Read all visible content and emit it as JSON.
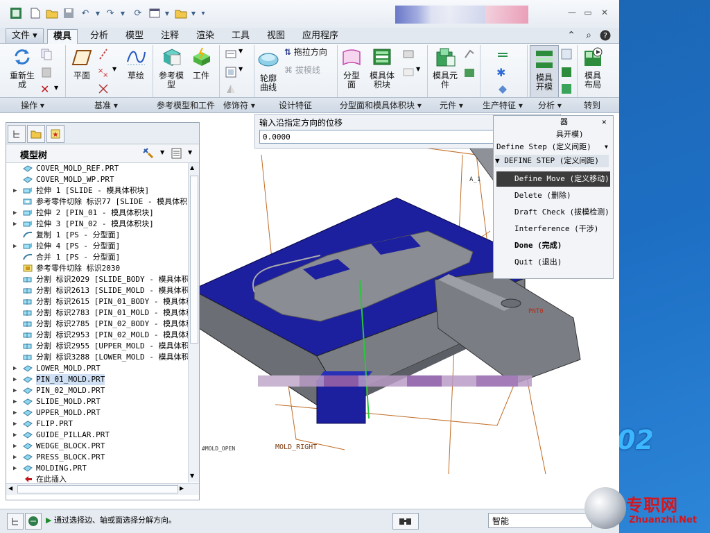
{
  "quick_access": {
    "icons": [
      "app-icon",
      "new-icon",
      "open-icon",
      "save-icon",
      "undo-icon",
      "redo-icon",
      "regenerate-icon",
      "windows-icon",
      "folder-icon",
      "customize-icon"
    ]
  },
  "tabs": [
    {
      "label": "文件",
      "kind": "file"
    },
    {
      "label": "模具",
      "active": true
    },
    {
      "label": "分析"
    },
    {
      "label": "模型"
    },
    {
      "label": "注释"
    },
    {
      "label": "渲染"
    },
    {
      "label": "工具"
    },
    {
      "label": "视图"
    },
    {
      "label": "应用程序"
    }
  ],
  "ribbon": {
    "buttons": {
      "regenerate": "重新生\n成",
      "plane": "平面",
      "sketch": "草绘",
      "ref_model": "参考模\n型",
      "workpiece": "工件",
      "contour_curve": "轮廓\n曲线",
      "drag_direction": "拖拉方向",
      "draft_line": "拔模线",
      "parting_surface": "分型\n面",
      "mold_volume": "模具体\n积块",
      "mold_component": "模具元\n件",
      "mold_open": "模具\n开模",
      "mold_layout": "模具\n布局"
    },
    "groups": [
      "操作",
      "基准",
      "参考模型和工件",
      "修饰符",
      "设计特征",
      "分型面和模具体积块",
      "元件",
      "生产特征",
      "分析",
      "转到"
    ]
  },
  "model_tree": {
    "title": "模型树",
    "rows": [
      {
        "label": "COVER_MOLD_REF.PRT",
        "icon": "part",
        "expand": false
      },
      {
        "label": "COVER_MOLD_WP.PRT",
        "icon": "part",
        "expand": false
      },
      {
        "label": "拉伸 1 [SLIDE - 模具体积块]",
        "icon": "extrude",
        "expand": true
      },
      {
        "label": "参考零件切除 标识77 [SLIDE - 模具体积",
        "icon": "cut",
        "expand": false
      },
      {
        "label": "拉伸 2 [PIN_01 - 模具体积块]",
        "icon": "extrude",
        "expand": true
      },
      {
        "label": "拉伸 3 [PIN_02 - 模具体积块]",
        "icon": "extrude",
        "expand": true
      },
      {
        "label": "复制 1 [PS - 分型面]",
        "icon": "surface",
        "expand": false
      },
      {
        "label": "拉伸 4 [PS - 分型面]",
        "icon": "extrude",
        "expand": true
      },
      {
        "label": "合并 1 [PS - 分型面]",
        "icon": "surface",
        "expand": false
      },
      {
        "label": "参考零件切除 标识2030",
        "icon": "cut2",
        "expand": false
      },
      {
        "label": "分割 标识2029 [SLIDE_BODY - 模具体积",
        "icon": "split",
        "expand": false
      },
      {
        "label": "分割 标识2613 [SLIDE_MOLD - 模具体积",
        "icon": "split",
        "expand": false
      },
      {
        "label": "分割 标识2615 [PIN_01_BODY - 模具体积",
        "icon": "split",
        "expand": false
      },
      {
        "label": "分割 标识2783 [PIN_01_MOLD - 模具体积",
        "icon": "split",
        "expand": false
      },
      {
        "label": "分割 标识2785 [PIN_02_BODY - 模具体积",
        "icon": "split",
        "expand": false
      },
      {
        "label": "分割 标识2953 [PIN_02_MOLD - 模具体积",
        "icon": "split",
        "expand": false
      },
      {
        "label": "分割 标识2955 [UPPER_MOLD - 模具体积",
        "icon": "split",
        "expand": false
      },
      {
        "label": "分割 标识3288 [LOWER_MOLD - 模具体积",
        "icon": "split",
        "expand": false
      },
      {
        "label": "LOWER_MOLD.PRT",
        "icon": "part",
        "expand": true
      },
      {
        "label": "PIN_01_MOLD.PRT",
        "icon": "part",
        "expand": true,
        "selected": true
      },
      {
        "label": "PIN_02_MOLD.PRT",
        "icon": "part",
        "expand": true
      },
      {
        "label": "SLIDE_MOLD.PRT",
        "icon": "part",
        "expand": true
      },
      {
        "label": "UPPER_MOLD.PRT",
        "icon": "part",
        "expand": true
      },
      {
        "label": "FLIP.PRT",
        "icon": "part",
        "expand": true
      },
      {
        "label": "GUIDE_PILLAR.PRT",
        "icon": "part",
        "expand": true
      },
      {
        "label": "WEDGE_BLOCK.PRT",
        "icon": "part",
        "expand": true
      },
      {
        "label": "PRESS_BLOCK.PRT",
        "icon": "part",
        "expand": true
      },
      {
        "label": "MOLDING.PRT",
        "icon": "part",
        "expand": true
      },
      {
        "label": "在此插入",
        "icon": "insert",
        "expand": false
      }
    ]
  },
  "input_dialog": {
    "prompt": "输入沿指定方向的位移",
    "value": "0.0000"
  },
  "menu_manager": {
    "partial_title": "器",
    "mold_open_label": "具开模)",
    "define_step_partial": "Define Step (定义间距)",
    "section": "DEFINE STEP (定义间距)",
    "items": [
      {
        "label": "Define Move (定义移动)",
        "active": true
      },
      {
        "label": "Delete (删除)"
      },
      {
        "label": "Draft Check (拔模检测)"
      },
      {
        "label": "Interference (干涉)"
      },
      {
        "label": "Done (完成)",
        "bold": true
      },
      {
        "label": "Quit (退出)"
      }
    ]
  },
  "viewport": {
    "labels": {
      "mold_right": "MOLD_RIGHT",
      "mold_open": "#MOLD_OPEN",
      "pnt": "PNT0",
      "a": "A_1"
    },
    "colors": {
      "blue_face": "#1c1f9e",
      "gray": "#7a7d83",
      "line_orange": "#c06a22",
      "axis_green": "#29c73a"
    }
  },
  "status": {
    "message": "通过选择边、轴或面选择分解方向。",
    "filter": "智能"
  },
  "desktop": {
    "text": "02"
  },
  "watermark": {
    "brand": "专职网",
    "url": "Zhuanzhi.Net"
  }
}
